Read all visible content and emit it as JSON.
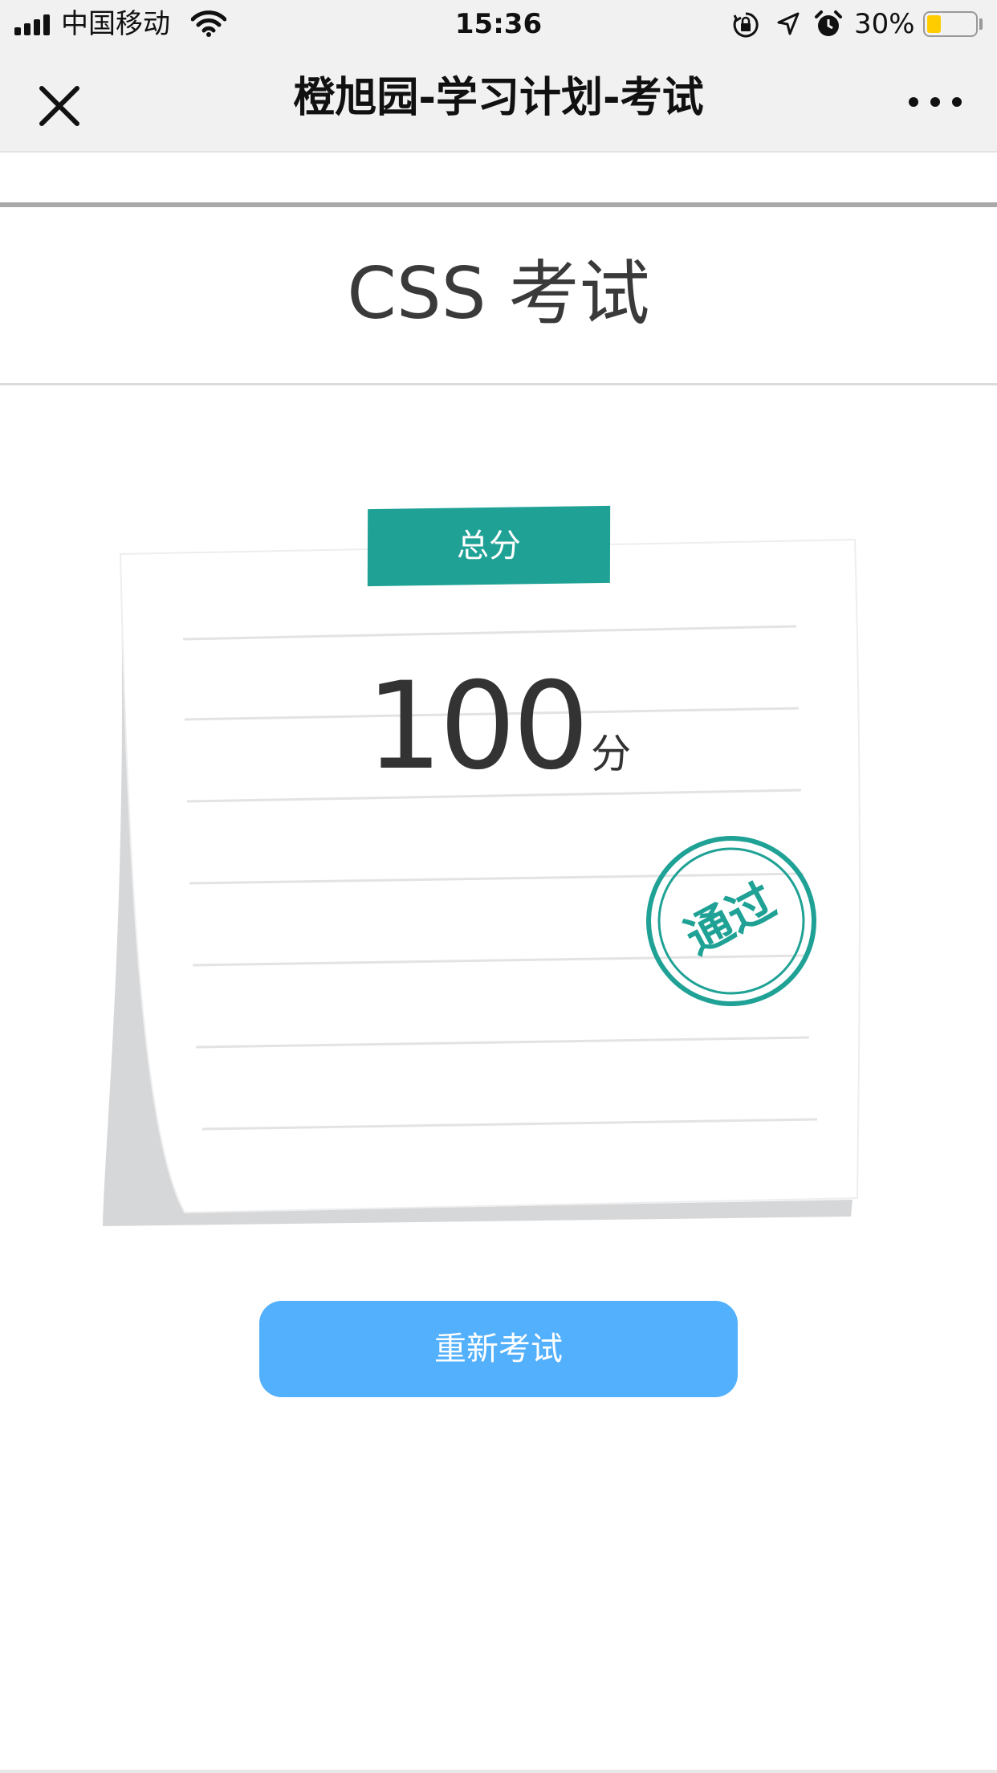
{
  "status_bar": {
    "carrier": "中国移动",
    "time": "15:36",
    "battery_percent_text": "30%",
    "battery_level": 0.3,
    "icons": [
      "signal-icon",
      "wifi-icon",
      "rotation-lock-icon",
      "location-icon",
      "alarm-icon",
      "battery-icon"
    ]
  },
  "nav": {
    "title": "橙旭园-学习计划-考试",
    "close_icon": "close-icon",
    "more_icon": "more-icon"
  },
  "exam": {
    "title": "CSS 考试",
    "score_tag": "总分",
    "score_value": "100",
    "score_unit": "分",
    "stamp_text": "通过",
    "stamp_color": "#1fa295"
  },
  "actions": {
    "retake_label": "重新考试"
  },
  "colors": {
    "accent_green": "#1fa295",
    "button_blue": "#52b0fc"
  }
}
